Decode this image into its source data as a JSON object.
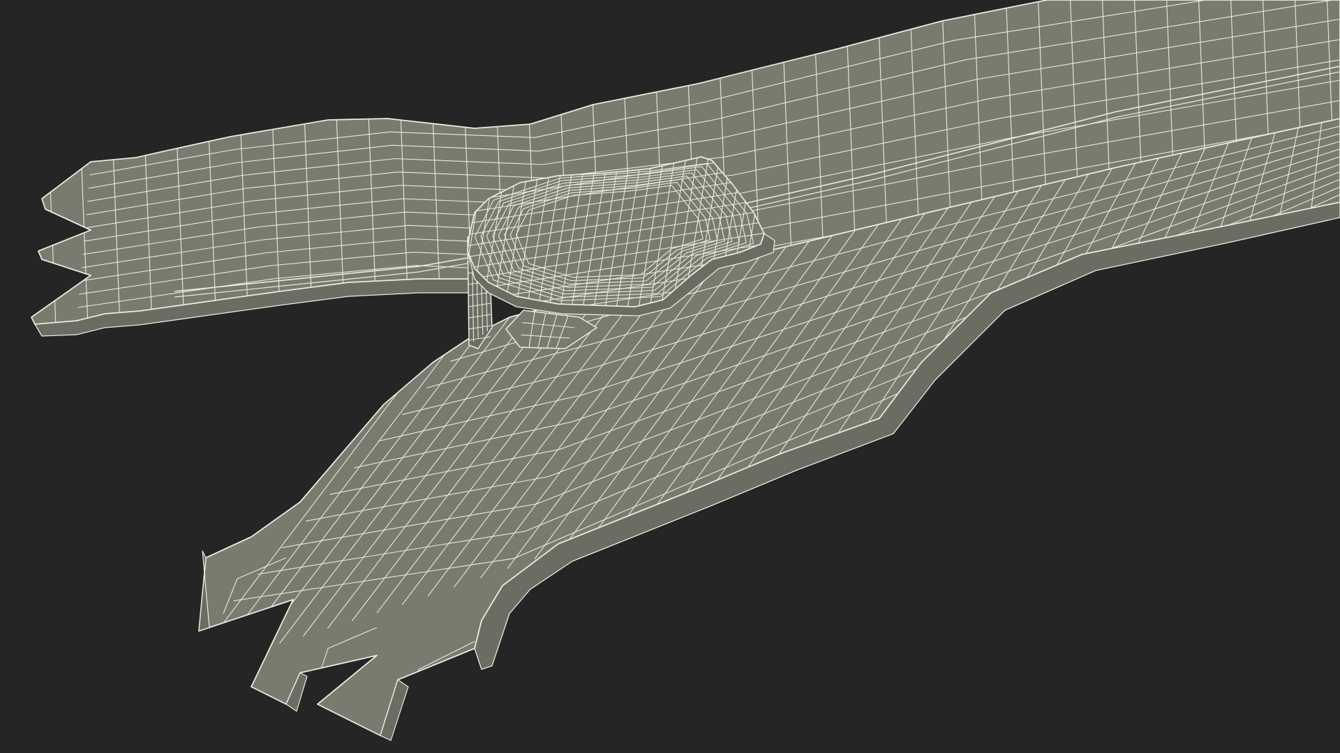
{
  "scene": {
    "background_color": "#252525",
    "mesh_fill_color": "#7a7a6f",
    "mesh_shade_color": "#6c6c62",
    "wire_color": "#ecebdf",
    "object": "wireframe-3d-mesh"
  }
}
